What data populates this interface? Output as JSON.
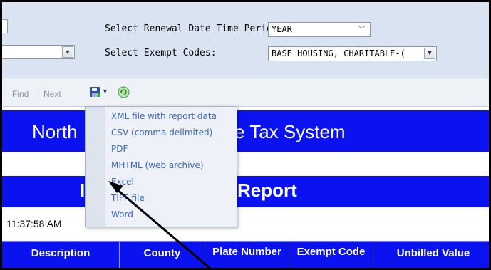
{
  "params": {
    "renewal_label": "Select Renewal Date Time Period",
    "renewal_value": "YEAR",
    "exempt_label": "Select Exempt Codes:",
    "exempt_value": "BASE HOUSING, CHARITABLE-("
  },
  "toolbar": {
    "find_label": "Find",
    "separator": "|",
    "next_label": "Next",
    "save_icon": "save-disk-icon",
    "refresh_icon": "refresh-icon"
  },
  "export_menu": {
    "items": [
      "XML file with report data",
      "CSV (comma delimited)",
      "PDF",
      "MHTML (web archive)",
      "Excel",
      "TIFF file",
      "Word"
    ]
  },
  "report": {
    "title_left": "North",
    "title_right": "e Tax System",
    "subtitle_left": "I",
    "subtitle_right": "Report",
    "timestamp": "11:37:58 AM",
    "columns": [
      "Description",
      "County",
      "Plate Number",
      "Exempt Code",
      "Unbilled Value"
    ]
  },
  "colors": {
    "banner": "#0a12ef",
    "param_bg": "#d9e3f1",
    "menu_text": "#3a63c4"
  }
}
